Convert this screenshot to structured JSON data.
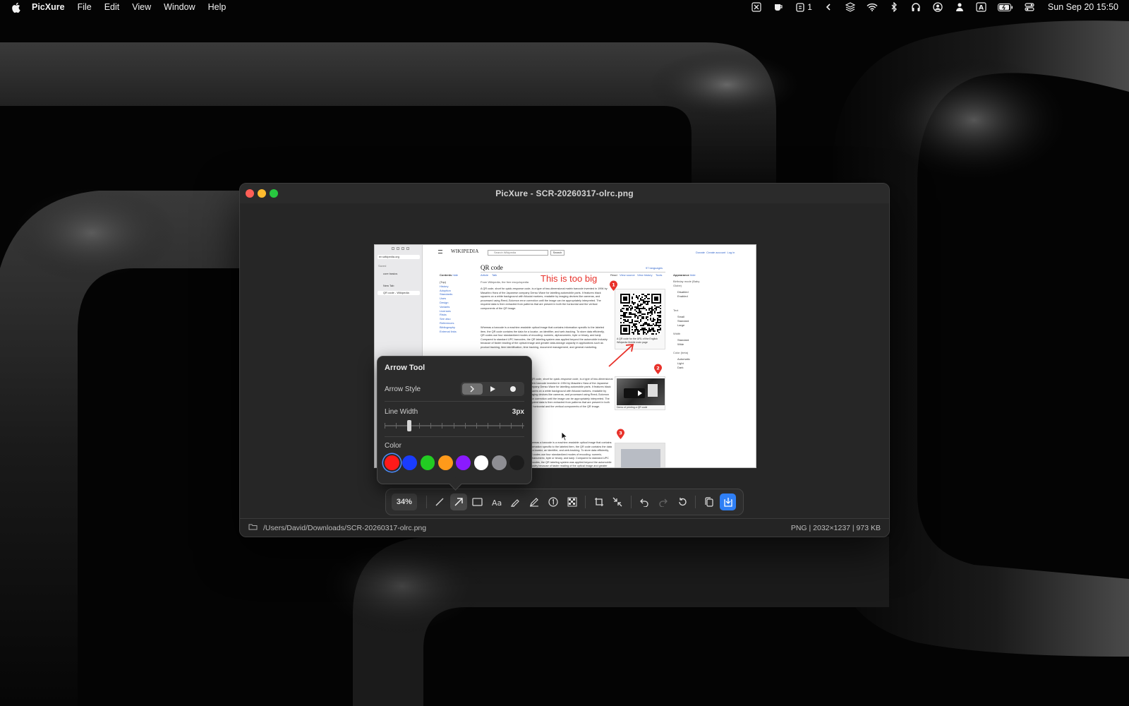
{
  "menubar": {
    "app_name": "PicXure",
    "menus": [
      "File",
      "Edit",
      "View",
      "Window",
      "Help"
    ],
    "clipboard_count": "1",
    "clock": "Sun Sep 20  15:50"
  },
  "window": {
    "title": "PicXure - SCR-20260317-olrc.png",
    "file_path": "/Users/David/Downloads/SCR-20260317-olrc.png",
    "file_info": "PNG | 2032×1237 | 973 KB"
  },
  "annotations": {
    "text": "This is too big",
    "markers": [
      "1",
      "2",
      "3"
    ],
    "color": "#e8312a"
  },
  "screenshot_content": {
    "url": "en.wikipedia.org",
    "sidebar_items": [
      "Saved",
      "core basics",
      "New Tab",
      "QR code - Wikipedia"
    ],
    "search_placeholder": "Search Wikipedia",
    "search_button": "Search",
    "user_links": "Donate  Create account  Log in",
    "article_title": "QR code",
    "languages": "97 languages",
    "tabs": [
      "Article",
      "Talk"
    ],
    "view_tabs": [
      "Read",
      "View source",
      "View history",
      "Tools"
    ],
    "from_line": "From Wikipedia, the free encyclopedia",
    "contents_title": "Contents",
    "contents_hide": "hide",
    "contents": [
      "(Top)",
      "History",
      "Adoption",
      "Standards",
      "Uses",
      "Design",
      "Variants",
      "Licenses",
      "Risks",
      "See also",
      "References",
      "Bibliography",
      "External links"
    ],
    "paragraph1": "A QR code, short for quick-response code, is a type of two-dimensional matrix barcode invented in 1994 by Masahiro Hara of the Japanese company Denso Wave for labelling automobile parts. It features black squares on a white background with fiducial markers, readable by imaging devices like cameras, and processed using Reed–Solomon error correction until the image can be appropriately interpreted. The required data is then extracted from patterns that are present in both the horizontal and the vertical components of the QR image.",
    "paragraph2": "Whereas a barcode is a machine-readable optical image that contains information specific to the labeled item, the QR code contains the data for a locator, an identifier, and web-tracking. To store data efficiently, QR codes use four standardized modes of encoding: numeric, alphanumeric, byte or binary, and kanji. Compared to standard UPC barcodes, the QR labeling system was applied beyond the automobile industry because of faster reading of the optical image and greater data-storage capacity in applications such as product tracking, item identification, time tracking, document management, and general marketing.",
    "caption1": "A QR code for the URL of the English Wikipedia Mobile main page",
    "caption2": "Demo of printing a QR code",
    "appearance_title": "Appearance",
    "appearance_hide": "hide",
    "appearance_groups": [
      "Birthday mode (Baby Globe)",
      "Text",
      "Width",
      "Color (beta)"
    ],
    "appearance_options": [
      "Disabled",
      "Enabled",
      "Small",
      "Standard",
      "Large",
      "Standard",
      "Wide",
      "Automatic",
      "Light",
      "Dark"
    ]
  },
  "arrow_tool": {
    "title": "Arrow Tool",
    "arrow_style_label": "Arrow Style",
    "arrow_styles": [
      "open-chevron",
      "filled-triangle",
      "dot"
    ],
    "selected_style": 0,
    "line_width_label": "Line Width",
    "line_width_value": "3px",
    "line_width_fraction": 0.17,
    "color_label": "Color",
    "colors": [
      "#ff1a1a",
      "#1a3cff",
      "#22cc22",
      "#ff9a1a",
      "#8a1aff",
      "#ffffff",
      "#8e8e93",
      "#1c1c1c"
    ],
    "selected_color": 0
  },
  "toolbar": {
    "zoom": "34%",
    "tools": [
      "line-tool",
      "arrow-tool",
      "rectangle-tool",
      "text-tool",
      "highlighter-tool",
      "pen-tool",
      "counter-tool",
      "pixelate-tool",
      "crop-tool",
      "resize-tool",
      "undo",
      "redo",
      "revert",
      "copy",
      "save"
    ]
  }
}
